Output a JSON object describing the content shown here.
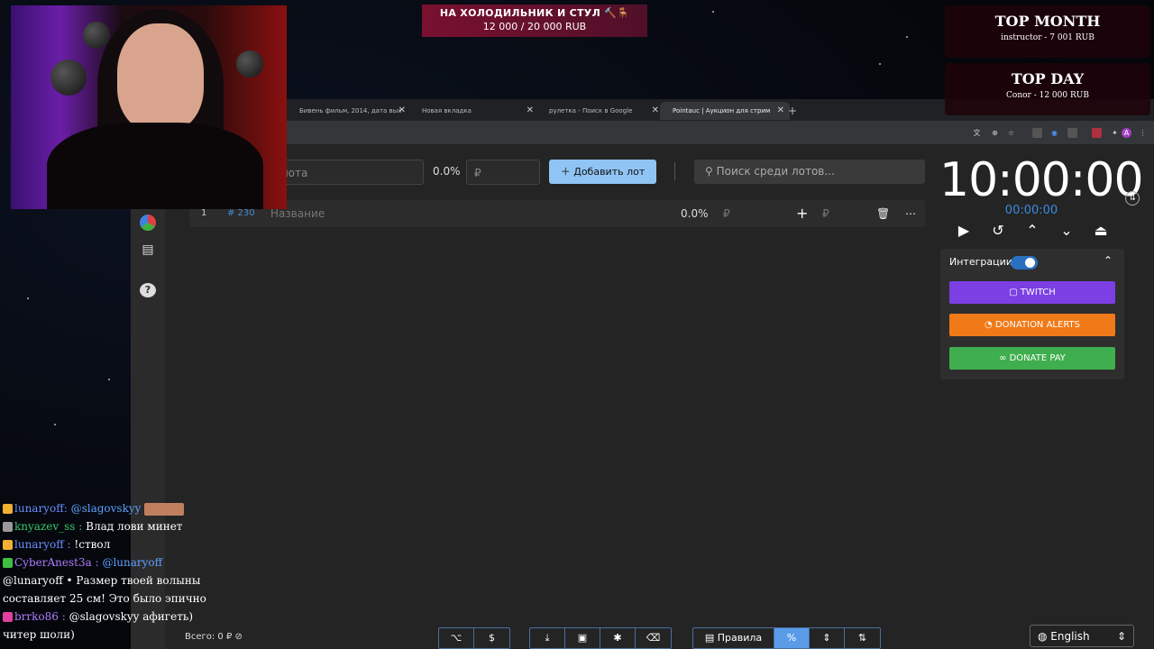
{
  "goal": {
    "title": "НА ХОЛОДИЛЬНИК И СТУЛ 🔨🪑",
    "amount": "12 000 / 20 000 RUB",
    "progress": 0.6
  },
  "top_month": {
    "title": "TOP MONTH",
    "detail": "instructor - 7 001 RUB"
  },
  "top_day": {
    "title": "TOP DAY",
    "detail": "Conor - 12 000 RUB"
  },
  "browser": {
    "tabs": [
      {
        "label": "Бивень фильм, 2014, дата вых"
      },
      {
        "label": "Новая вкладка"
      },
      {
        "label": "рулетка - Поиск в Google"
      },
      {
        "label": "Pointauc | Аукцион для стрим"
      }
    ],
    "new_tab": "+"
  },
  "app": {
    "lot_name_placeholder": "лота",
    "percent": "0.0%",
    "amount_placeholder": "₽",
    "add_lot": "Добавить лот",
    "search_placeholder": "Поиск среди лотов...",
    "lot_row": {
      "index": "1",
      "id": "# 230",
      "name_placeholder": "Название",
      "percent": "0.0%",
      "currency": "₽",
      "plus": "+",
      "currency2": "₽"
    },
    "timer": {
      "main": "10:00:00",
      "sub": "00:00:00"
    },
    "integrations": {
      "label": "Интеграции",
      "enabled": true,
      "buttons": [
        "TWITCH",
        "DONATION ALERTS",
        "DONATE PAY"
      ],
      "colors": [
        "#7b3fe4",
        "#f07a17",
        "#3fae4e"
      ]
    },
    "bottom": {
      "total": "Всего: 0 ₽",
      "rules": "Правила",
      "language": "English"
    }
  },
  "chat": [
    {
      "user": "lunaryoff",
      "sep": ":",
      "text": "@slagovskyy",
      "color": "#6a8cff",
      "badge": "#f0b030"
    },
    {
      "user": "knyazev_ss",
      "sep": ":",
      "text": "Влад лови минет",
      "color": "#37c86b",
      "badge": "#9a9a9a"
    },
    {
      "user": "lunaryoff",
      "sep": ":",
      "text": "!ствол",
      "color": "#6a8cff",
      "badge": "#f0b030"
    },
    {
      "user": "CyberAnest3a",
      "sep": ":",
      "text": "@lunaryoff",
      "color": "#b07cff",
      "badge": "#3fbf3f"
    },
    {
      "user": "",
      "sep": "",
      "text": "@lunaryoff • Размер твоей волыны составляет 25 см! Это было эпично",
      "color": "#5ea0ff",
      "badge": ""
    },
    {
      "user": "brrko86",
      "sep": ":",
      "text": "@slagovskyy афигеть) читер шоли)",
      "color": "#b07cff",
      "badge": "#e040a0"
    }
  ]
}
